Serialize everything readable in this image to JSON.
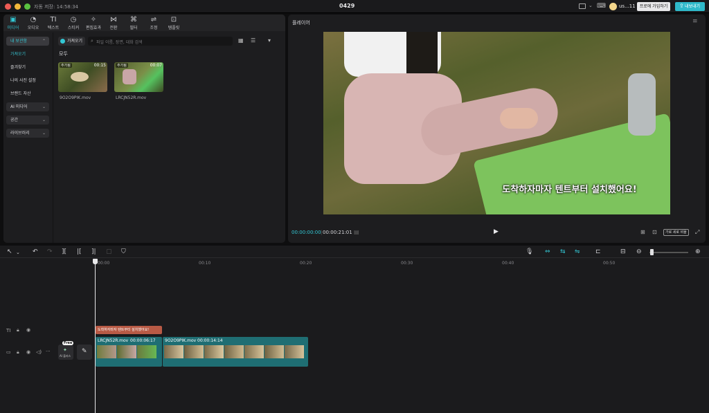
{
  "titlebar": {
    "autosave": "자동 저장: 14:58:34",
    "project": "0429",
    "user": "us...11",
    "join_btn": "프로에 가입하기",
    "export_btn": "내보내기"
  },
  "toolbar": [
    {
      "label": "미디어",
      "icon": "media-icon"
    },
    {
      "label": "오디오",
      "icon": "audio-icon"
    },
    {
      "label": "텍스트",
      "icon": "text-icon"
    },
    {
      "label": "스티커",
      "icon": "sticker-icon"
    },
    {
      "label": "편집효과",
      "icon": "effects-icon"
    },
    {
      "label": "전환",
      "icon": "transition-icon"
    },
    {
      "label": "필터",
      "icon": "filter-icon"
    },
    {
      "label": "조정",
      "icon": "adjust-icon"
    },
    {
      "label": "템플릿",
      "icon": "template-icon"
    }
  ],
  "sidebar": {
    "my_storage": "내 보관함",
    "import": "가져오기",
    "favorites": "즐겨찾기",
    "my_photo_settings": "나의 사진 설정",
    "brand_assets": "브랜드 자산",
    "ai_media": "AI 미디어",
    "space": "공간",
    "library": "라이브러리"
  },
  "media": {
    "import_btn": "가져오기",
    "search_placeholder": "파일 이름, 장면, 대화 검색",
    "all_label": "모두",
    "items": [
      {
        "badge": "추가됨",
        "duration": "00:15",
        "name": "9O2O9PIK.mov"
      },
      {
        "badge": "추가됨",
        "duration": "00:07",
        "name": "LRCJN52R.mov"
      }
    ]
  },
  "player": {
    "title": "플레이어",
    "subtitle": "도착하자마자 텐트부터 설치했어요!",
    "current": "00:00:00:00",
    "total": "00:00:21:01",
    "ratio_btn": "가로 세로 비율"
  },
  "timeline": {
    "ticks": [
      "00:00",
      "00:10",
      "00:20",
      "00:30",
      "00:40",
      "00:50"
    ],
    "text_clip": "도착하자마자 텐트부터 설치했어요!",
    "clips": [
      {
        "name": "LRCJN52R.mov",
        "duration": "00:00:06:17"
      },
      {
        "name": "9O2O9PIK.mov",
        "duration": "00:00:14:14"
      }
    ],
    "free_badge": "Free",
    "ai_label": "AI 플러스"
  },
  "colors": {
    "accent": "#33c7d4",
    "clip": "#1f6e73",
    "textclip": "#b85a45"
  }
}
